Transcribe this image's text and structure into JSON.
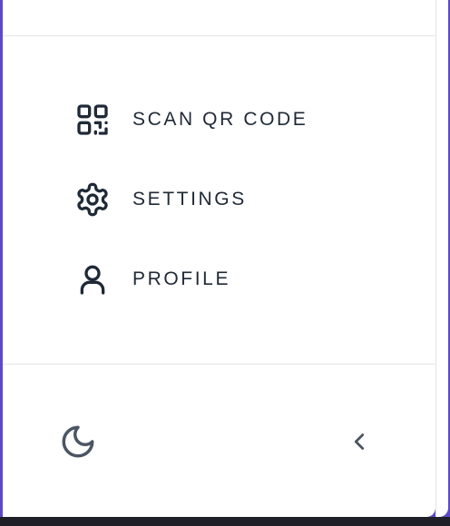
{
  "nav": {
    "items": [
      {
        "label": "SCAN QR CODE",
        "icon": "qr-code-icon"
      },
      {
        "label": "SETTINGS",
        "icon": "gear-icon"
      },
      {
        "label": "PROFILE",
        "icon": "user-icon"
      }
    ]
  },
  "footer": {
    "theme_toggle_icon": "moon-icon",
    "collapse_icon": "chevron-left-icon"
  },
  "colors": {
    "accent": "#5b49c7",
    "text": "#1f2937",
    "icon": "#1f2937",
    "muted_icon": "#4b5563",
    "divider": "#e4e4e7"
  }
}
